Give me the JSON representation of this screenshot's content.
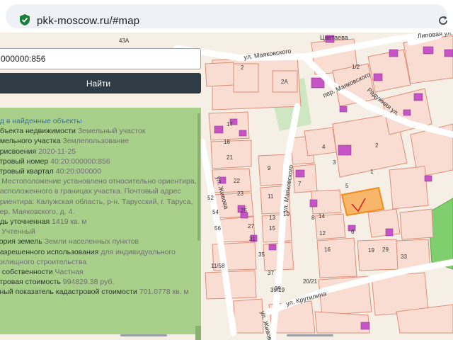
{
  "browser": {
    "url": "pkk-moscow.ru/#map"
  },
  "search": {
    "value": "000000:856",
    "button_label": "Найти"
  },
  "info": {
    "back_link": "ад в найденные объекты",
    "rows": [
      {
        "label": "объекта недвижимости",
        "value": "Земельный участок"
      },
      {
        "label": "емельного участка",
        "value": "Землепользование"
      },
      {
        "label": "присвоения",
        "value": "2020-11-25"
      },
      {
        "label": "стровый номер",
        "value": "40:20:000000:856"
      },
      {
        "label": "стровый квартал",
        "value": "40:20:000000"
      },
      {
        "label": "с",
        "value": "Местоположение установлено относительно ориентира, расположенного в границах участка. Почтовый адрес ориентира: Калужская область, р-н. Тарусский, г. Таруса, пер. Маяковского, д. 4."
      },
      {
        "label": "адь уточненная",
        "value": "1419 кв. м"
      },
      {
        "label": "с",
        "value": "Учтенный"
      },
      {
        "label": "тория земель",
        "value": "Земли населенных пунктов"
      },
      {
        "label": "разрешенного использования",
        "value": "для индивидуального жилищного строительства"
      },
      {
        "label": "а собственности",
        "value": "Частная"
      },
      {
        "label": "стровая стоимость",
        "value": "994829.38 руб."
      },
      {
        "label": "ьный показатель кадастровой стоимости",
        "value": "701.0778 кв. м"
      }
    ]
  },
  "map": {
    "streets": [
      "ул. Маяковского",
      "пер. Маяковского",
      "Радужная ул.",
      "ул. Маяковского",
      "ул. Живова",
      "ул. Крутилина",
      "ул. Живова",
      "Липовая ул.",
      "Цветаева"
    ],
    "house_numbers": [
      "2",
      "2А",
      "1/2",
      "2",
      "5",
      "4",
      "3",
      "6",
      "7",
      "8",
      "9",
      "10",
      "11",
      "12",
      "13",
      "14",
      "15",
      "16",
      "17",
      "18",
      "19",
      "21",
      "22",
      "23",
      "25",
      "27",
      "29",
      "31",
      "33",
      "35",
      "37",
      "39",
      "43А",
      "52",
      "54",
      "56",
      "11/58",
      "20/21",
      "39/19",
      "1"
    ]
  },
  "colors": {
    "panel": "#a8d08b",
    "button": "#2f3b45",
    "parcel": "#f9ddd3",
    "parcel_border": "#e08d78",
    "building": "#c654c7",
    "selected": "#f6a53a"
  }
}
